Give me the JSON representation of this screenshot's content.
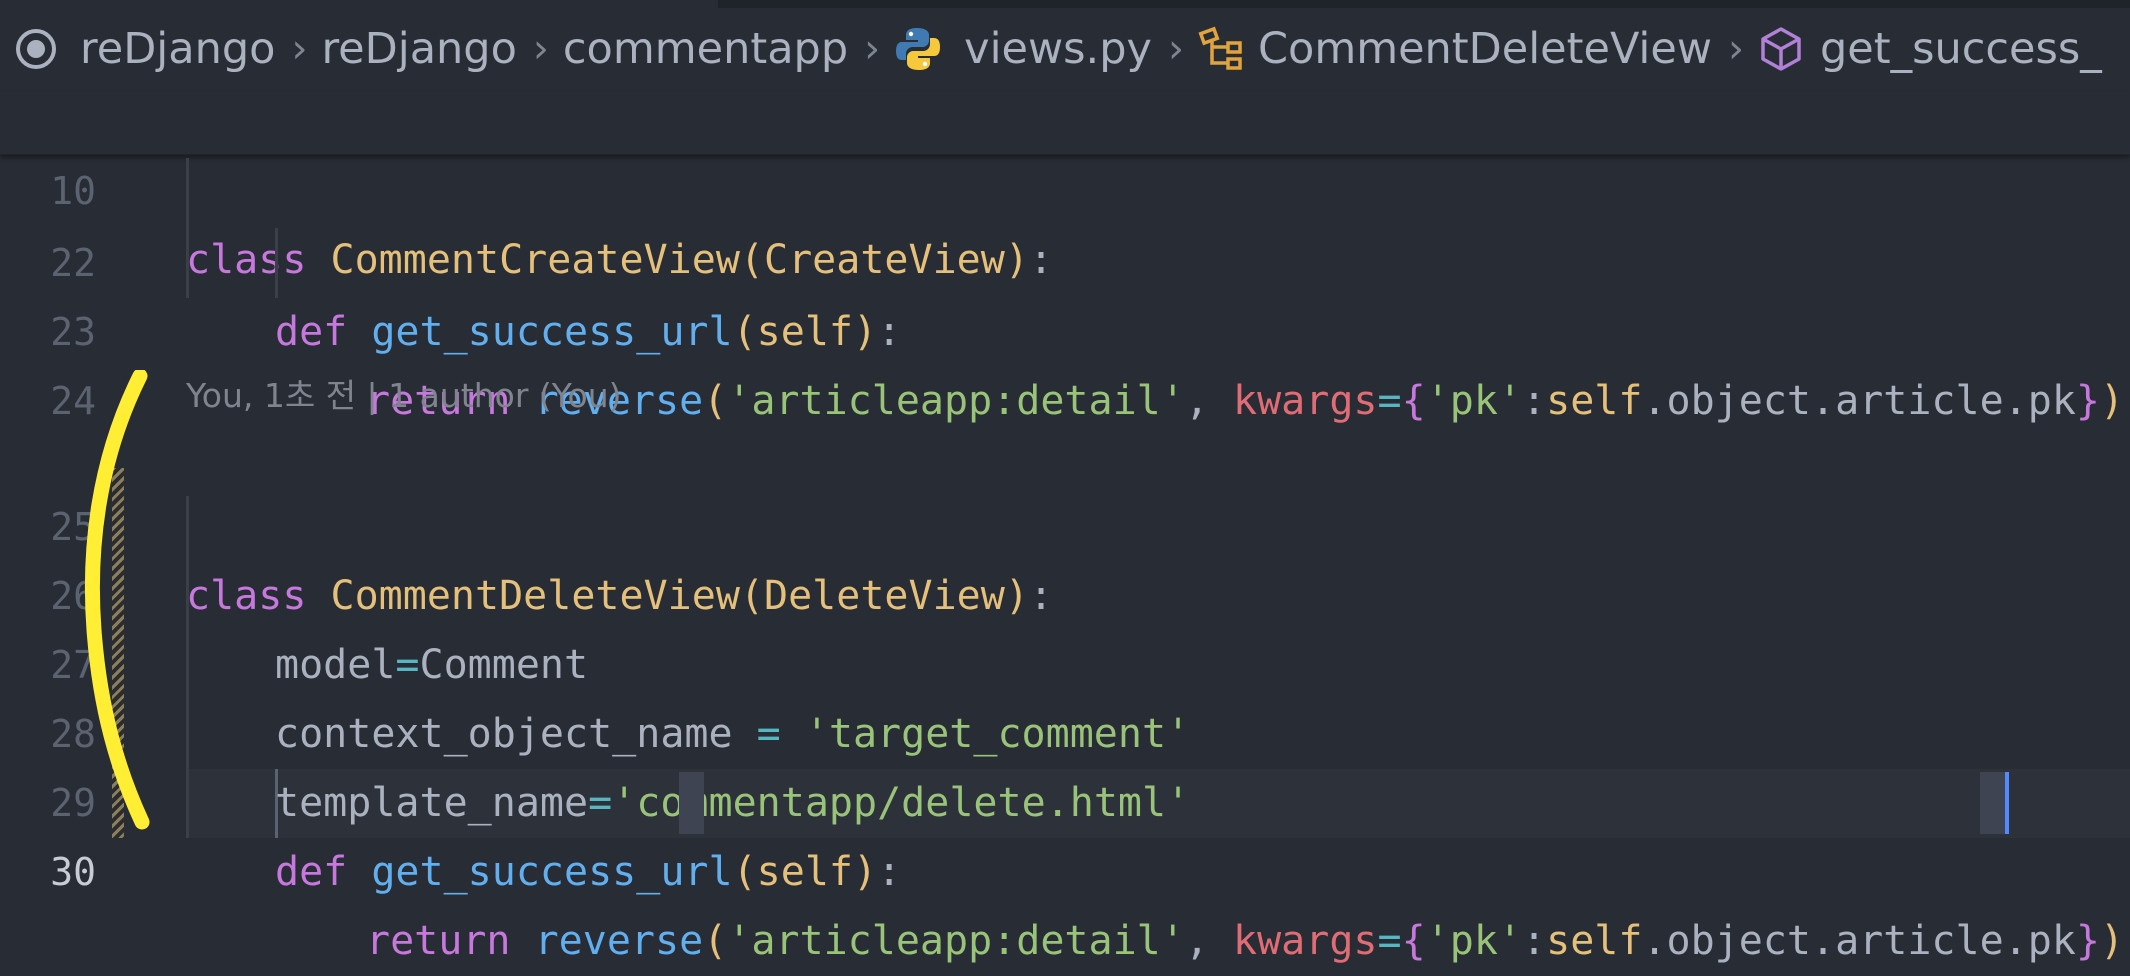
{
  "breadcrumb": {
    "items": [
      {
        "label": "reDjango",
        "icon": "repo-icon"
      },
      {
        "label": "reDjango"
      },
      {
        "label": "commentapp"
      },
      {
        "label": "views.py",
        "icon": "python-icon"
      },
      {
        "label": "CommentDeleteView",
        "icon": "class-icon"
      },
      {
        "label": "get_success_",
        "icon": "method-icon"
      }
    ]
  },
  "editor": {
    "sticky_line": {
      "number": "10",
      "t0": "class",
      "t1": " ",
      "t2": "CommentCreateView",
      "t3": "(",
      "t4": "CreateView",
      "t5": ")",
      "t6": ":"
    },
    "lines": [
      {
        "number": "22",
        "t0": "def",
        "t1": " ",
        "t2": "get_success_url",
        "t3": "(",
        "t4": "self",
        "t5": ")",
        "t6": ":"
      },
      {
        "number": "23",
        "t0": "return",
        "t1": " ",
        "t2": "reverse",
        "t3": "(",
        "t4": "'articleapp:detail'",
        "t5": ", ",
        "t6": "kwargs",
        "t7": "=",
        "t8": "{",
        "t9": "'pk'",
        "t10": ":",
        "t11": "self",
        "t12": ".object.article.pk",
        "t13": "}",
        "t14": ")"
      },
      {
        "number": "24"
      },
      {
        "number": "25",
        "t0": "class",
        "t1": " ",
        "t2": "CommentDeleteView",
        "t3": "(",
        "t4": "DeleteView",
        "t5": ")",
        "t6": ":"
      },
      {
        "number": "26",
        "t0": "model",
        "t1": "=",
        "t2": "Comment"
      },
      {
        "number": "27",
        "t0": "context_object_name",
        "t1": " = ",
        "t2": "'target_comment'"
      },
      {
        "number": "28",
        "t0": "template_name",
        "t1": "=",
        "t2": "'commentapp/delete.html'"
      },
      {
        "number": "29",
        "t0": "def",
        "t1": " ",
        "t2": "get_success_url",
        "t3": "(",
        "t4": "self",
        "t5": ")",
        "t6": ":"
      },
      {
        "number": "30",
        "t0": "return",
        "t1": " ",
        "t2": "reverse",
        "t3": "(",
        "t4": "'articleapp:detail'",
        "t5": ", ",
        "t6": "kwargs",
        "t7": "=",
        "t8": "{",
        "t9": "'pk'",
        "t10": ":",
        "t11": "self",
        "t12": ".object.article.pk",
        "t13": "}",
        "t14": ")"
      }
    ],
    "codelens": "You, 1초 전 | 1 author (You)"
  },
  "colors": {
    "background": "#282c34",
    "keyword": "#c678dd",
    "class_name": "#e5c07b",
    "function": "#61afef",
    "string": "#98c379",
    "param": "#e06c75",
    "annotation": "#ffee33"
  }
}
